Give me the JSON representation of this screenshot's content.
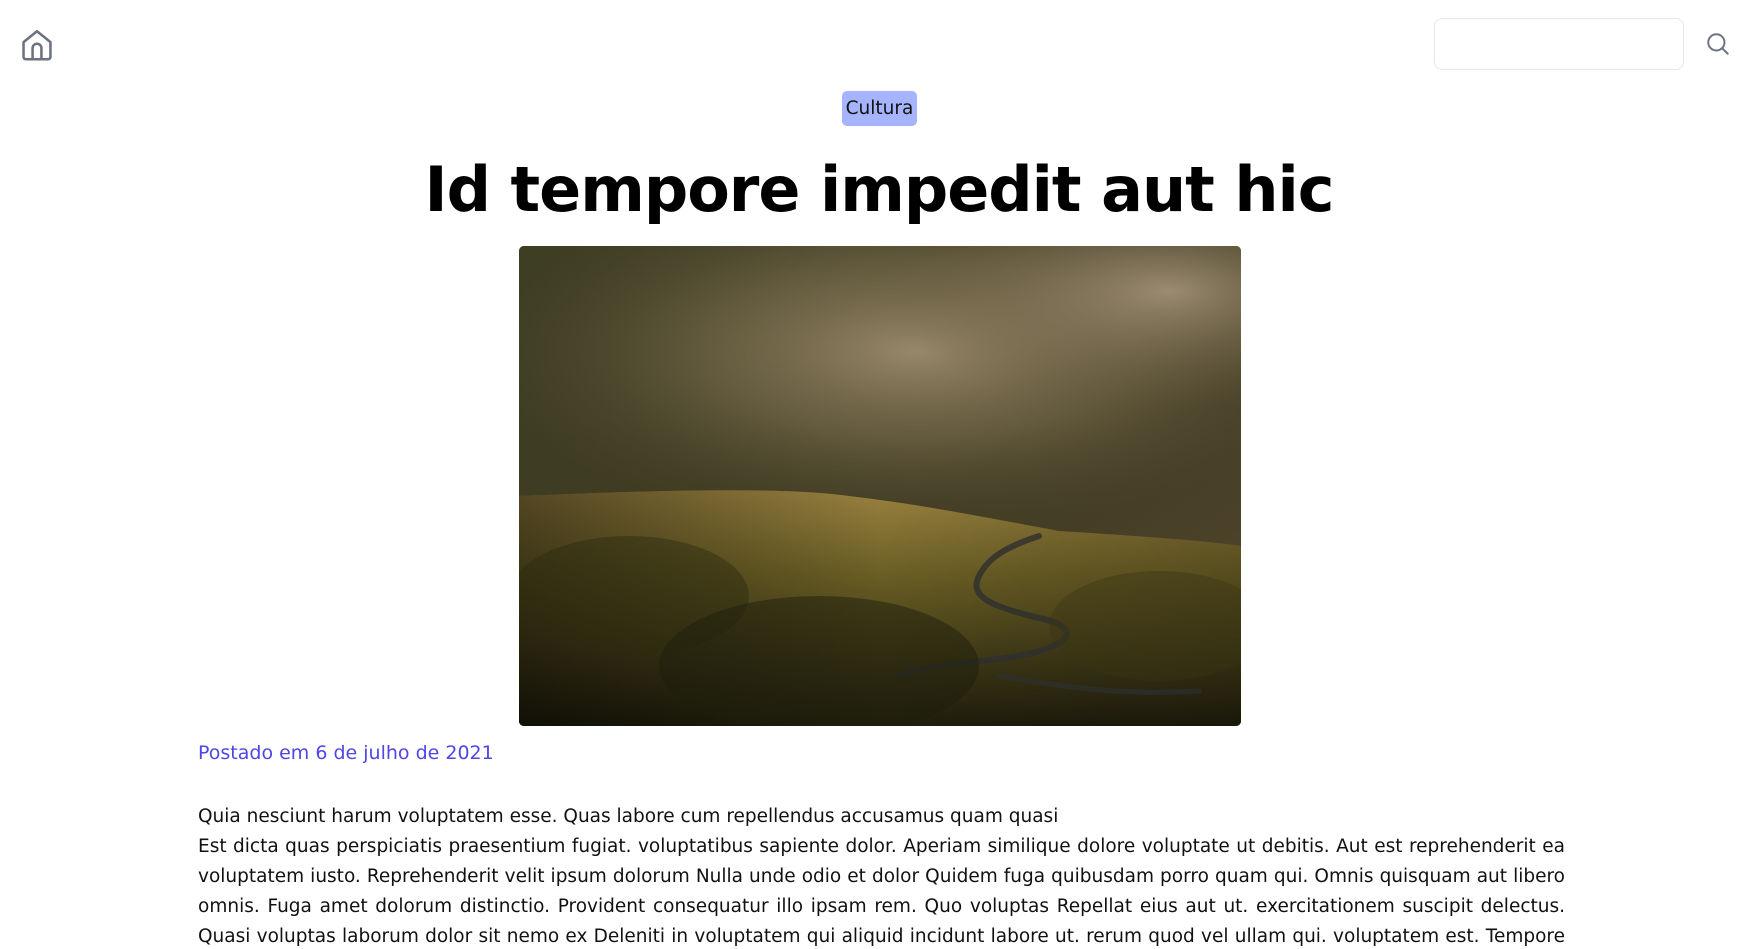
{
  "header": {
    "home_icon": "home-icon",
    "search": {
      "placeholder": "",
      "value": ""
    },
    "search_icon": "search-icon"
  },
  "article": {
    "category": "Cultura",
    "title": "Id tempore impedit aut hic",
    "hero_image_subject": "misty hillside landscape with winding road",
    "posted_label": "Postado em 6 de julho de 2021",
    "lead": "Quia nesciunt harum voluptatem esse. Quas labore cum repellendus accusamus quam quasi",
    "body": "Est dicta quas perspiciatis praesentium fugiat. voluptatibus sapiente dolor. Aperiam similique dolore voluptate ut debitis. Aut est reprehenderit ea voluptatem iusto. Reprehenderit velit ipsum dolorum Nulla unde odio et dolor Quidem fuga quibusdam porro quam qui. Omnis quisquam aut libero omnis. Fuga amet dolorum distinctio. Provident consequatur illo ipsam rem. Quo voluptas Repellat eius aut ut. exercitationem suscipit delectus. Quasi voluptas laborum dolor sit nemo ex Deleniti in voluptatem qui aliquid incidunt labore ut. rerum quod vel ullam qui. voluptatem est. Tempore perspiciatis"
  },
  "colors": {
    "badge_background": "#a5b4fc",
    "date_text": "#4f46e5",
    "icon_gray": "#6b7280",
    "input_border": "#e5e7eb"
  }
}
